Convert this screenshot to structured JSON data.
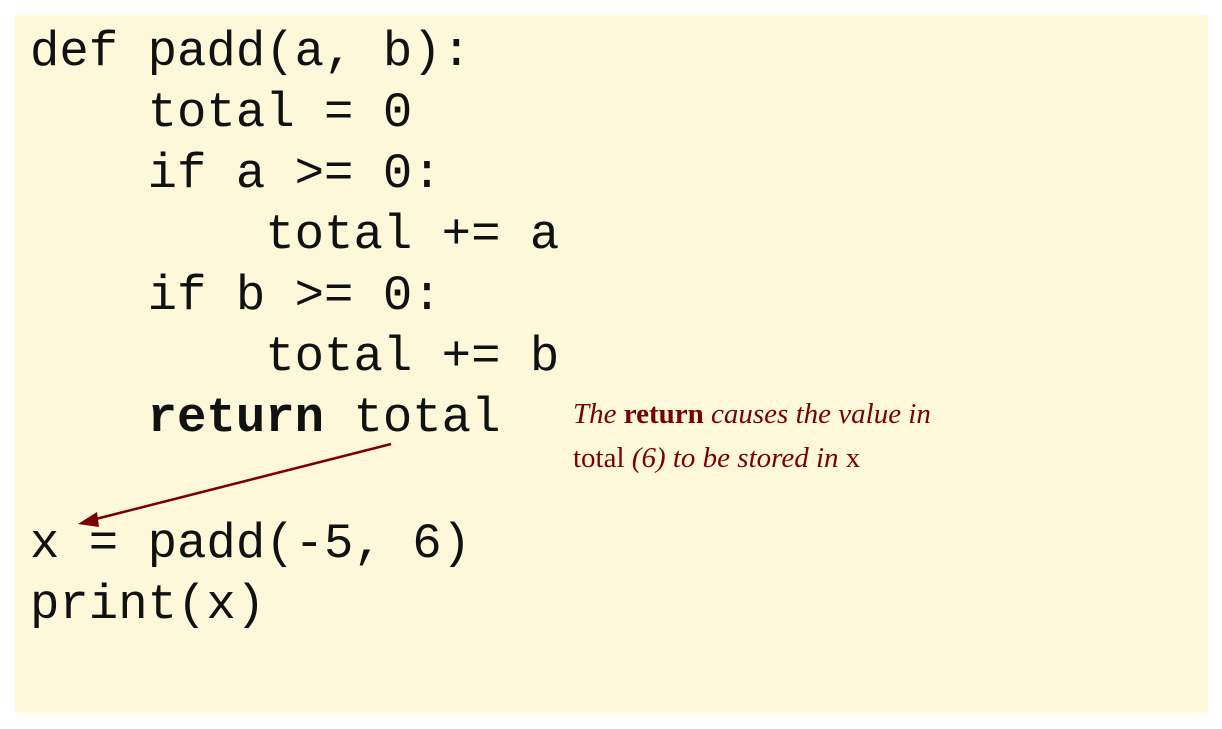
{
  "code": {
    "line1": "def padd(a, b):",
    "line2": "    total = 0",
    "line3": "    if a >= 0:",
    "line4": "        total += a",
    "line5": "    if b >= 0:",
    "line6": "        total += b",
    "line7_indent": "    ",
    "line7_keyword": "return",
    "line7_rest": " total",
    "line8": "x = padd(-5, 6)",
    "line9": "print(x)"
  },
  "annotation": {
    "part1": "The ",
    "part2": "return",
    "part3": " causes the value in ",
    "part4": "total",
    "part5": " (6) to be stored in ",
    "part6": "x"
  },
  "colors": {
    "panel_background": "#fdf8d9",
    "annotation_color": "#7a0000",
    "code_color": "#111111"
  }
}
